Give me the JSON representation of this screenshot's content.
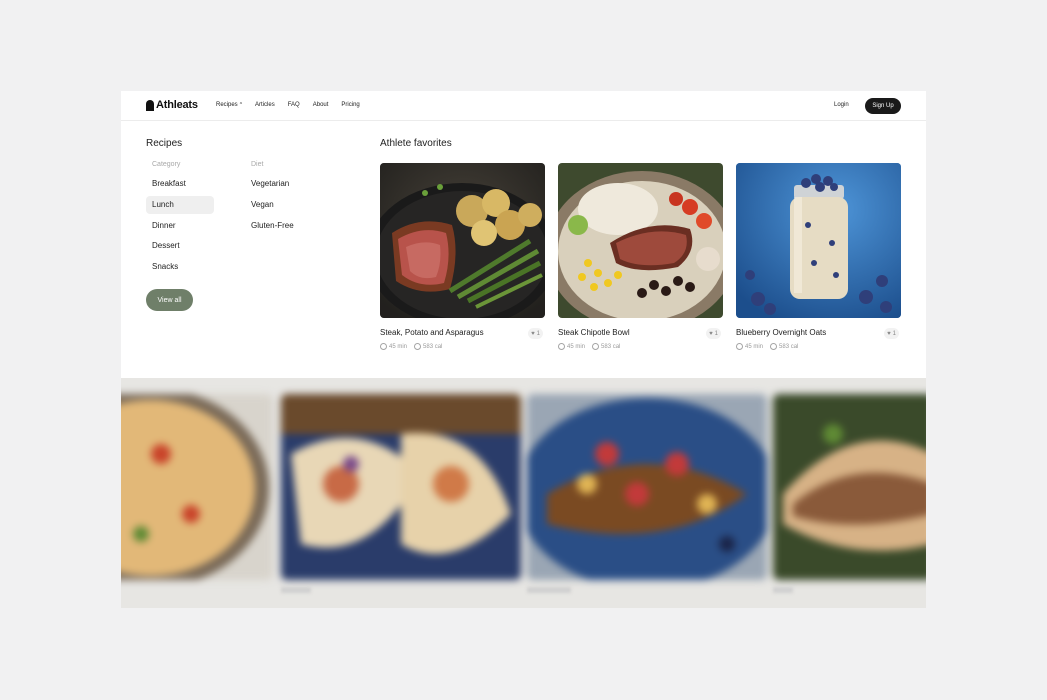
{
  "brand": {
    "name": "Athleats"
  },
  "nav": {
    "links": [
      {
        "label": "Recipes",
        "has_chevron": true,
        "chevron": "^"
      },
      {
        "label": "Articles"
      },
      {
        "label": "FAQ"
      },
      {
        "label": "About"
      },
      {
        "label": "Pricing"
      }
    ],
    "login_label": "Login",
    "signup_label": "Sign Up"
  },
  "menu": {
    "title": "Recipes",
    "category": {
      "heading": "Category",
      "items": [
        "Breakfast",
        "Lunch",
        "Dinner",
        "Dessert",
        "Snacks"
      ],
      "active": "Lunch"
    },
    "diet": {
      "heading": "Diet",
      "items": [
        "Vegetarian",
        "Vegan",
        "Gluten-Free"
      ]
    },
    "view_all_label": "View all",
    "accent_color": "#6f7f69"
  },
  "favorites": {
    "title": "Athlete favorites",
    "cards": [
      {
        "name": "Steak, Potato and Asparagus",
        "likes": "1",
        "time": "45 min",
        "calories": "583 cal",
        "image_icon": "steak-potato-asparagus-photo"
      },
      {
        "name": "Steak Chipotle Bowl",
        "likes": "1",
        "time": "45 min",
        "calories": "583 cal",
        "image_icon": "steak-chipotle-bowl-photo"
      },
      {
        "name": "Blueberry Overnight Oats",
        "likes": "1",
        "time": "45 min",
        "calories": "583 cal",
        "image_icon": "blueberry-oats-photo"
      }
    ]
  },
  "blurred_strip": {
    "images": [
      "pasta-photo",
      "fish-tacos-photo",
      "french-toast-photo",
      "quesadilla-photo"
    ]
  }
}
